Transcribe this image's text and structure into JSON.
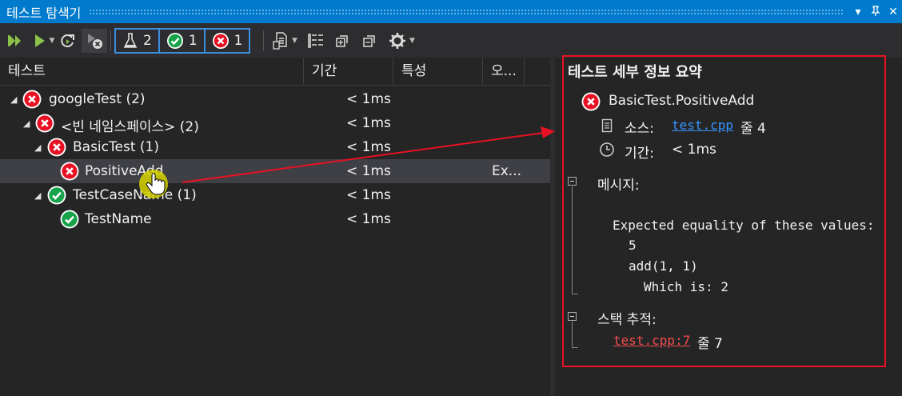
{
  "window": {
    "title": "테스트 탐색기"
  },
  "toolbar": {
    "filters": [
      {
        "count": "2",
        "icon": "flask-icon"
      },
      {
        "count": "1",
        "icon": "passed-icon"
      },
      {
        "count": "1",
        "icon": "failed-icon"
      }
    ]
  },
  "columns": [
    {
      "label": "테스트"
    },
    {
      "label": "기간"
    },
    {
      "label": "특성"
    },
    {
      "label": "오..."
    }
  ],
  "tree": [
    {
      "name": "googleTest (2)",
      "status": "failed",
      "duration": "< 1ms",
      "output": ""
    },
    {
      "name": "<빈 네임스페이스> (2)",
      "status": "failed",
      "duration": "< 1ms",
      "output": ""
    },
    {
      "name": "BasicTest (1)",
      "status": "failed",
      "duration": "< 1ms",
      "output": ""
    },
    {
      "name": "PositiveAdd",
      "status": "failed",
      "duration": "< 1ms",
      "output": "Ex..."
    },
    {
      "name": "TestCaseName (1)",
      "status": "passed",
      "duration": "< 1ms",
      "output": ""
    },
    {
      "name": "TestName",
      "status": "passed",
      "duration": "< 1ms",
      "output": ""
    }
  ],
  "details": {
    "heading": "테스트 세부 정보 요약",
    "test_name": "BasicTest.PositiveAdd",
    "source_label": "소스:",
    "source_file": "test.cpp",
    "source_line": "줄 4",
    "duration_label": "기간:",
    "duration_value": "< 1ms",
    "message_label": "메시지:",
    "message_lines": [
      "Expected equality of these values:",
      "5",
      "add(1, 1)",
      "Which is: 2"
    ],
    "stack_label": "스택 추적:",
    "stack_link": "test.cpp:7",
    "stack_line": "줄 7"
  },
  "colors": {
    "accent": "#007acc",
    "failed": "#e81123",
    "passed": "#16a34a",
    "link": "#3794ff",
    "annotation": "#e81123"
  }
}
